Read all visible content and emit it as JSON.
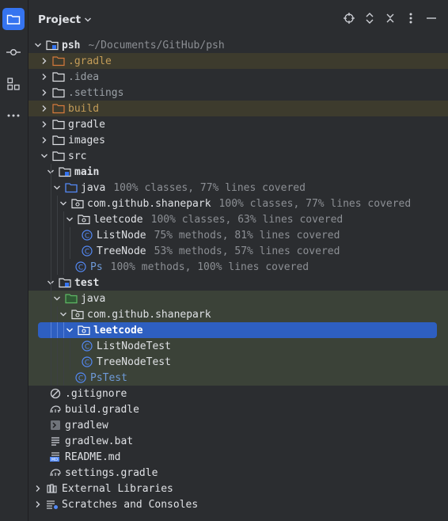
{
  "panel": {
    "title": "Project"
  },
  "toolbar": {
    "icons": [
      "project-folder-icon",
      "commit-icon",
      "structure-icon",
      "more-tools-icon"
    ],
    "actions": [
      "locate-icon",
      "expand-collapse-icon",
      "close-icon",
      "options-icon",
      "minimize-icon"
    ]
  },
  "tree": {
    "root": {
      "name": "psh",
      "path": "~/Documents/GitHub/psh"
    },
    "items": [
      {
        "label": ".gradle"
      },
      {
        "label": ".idea"
      },
      {
        "label": ".settings"
      },
      {
        "label": "build"
      },
      {
        "label": "gradle"
      },
      {
        "label": "images"
      },
      {
        "label": "src"
      },
      {
        "label": "main"
      },
      {
        "label": "java",
        "coverage": "100% classes, 77% lines covered"
      },
      {
        "label": "com.github.shanepark",
        "coverage": "100% classes, 77% lines covered"
      },
      {
        "label": "leetcode",
        "coverage": "100% classes, 63% lines covered"
      },
      {
        "label": "ListNode",
        "coverage": "75% methods, 81% lines covered"
      },
      {
        "label": "TreeNode",
        "coverage": "53% methods, 57% lines covered"
      },
      {
        "label": "Ps",
        "coverage": "100% methods, 100% lines covered"
      },
      {
        "label": "test"
      },
      {
        "label": "java"
      },
      {
        "label": "com.github.shanepark"
      },
      {
        "label": "leetcode"
      },
      {
        "label": "ListNodeTest"
      },
      {
        "label": "TreeNodeTest"
      },
      {
        "label": "PsTest"
      },
      {
        "label": ".gitignore"
      },
      {
        "label": "build.gradle"
      },
      {
        "label": "gradlew"
      },
      {
        "label": "gradlew.bat"
      },
      {
        "label": "README.md"
      },
      {
        "label": "settings.gradle"
      },
      {
        "label": "External Libraries"
      },
      {
        "label": "Scratches and Consoles"
      }
    ]
  },
  "colors": {
    "background": "#2b2d30",
    "selection": "#2e5fc1",
    "excluded_highlight": "#3d3b2d",
    "test_highlight": "#3b4238",
    "excluded_text": "#c39c58",
    "muted_text": "#9aa0a6"
  }
}
